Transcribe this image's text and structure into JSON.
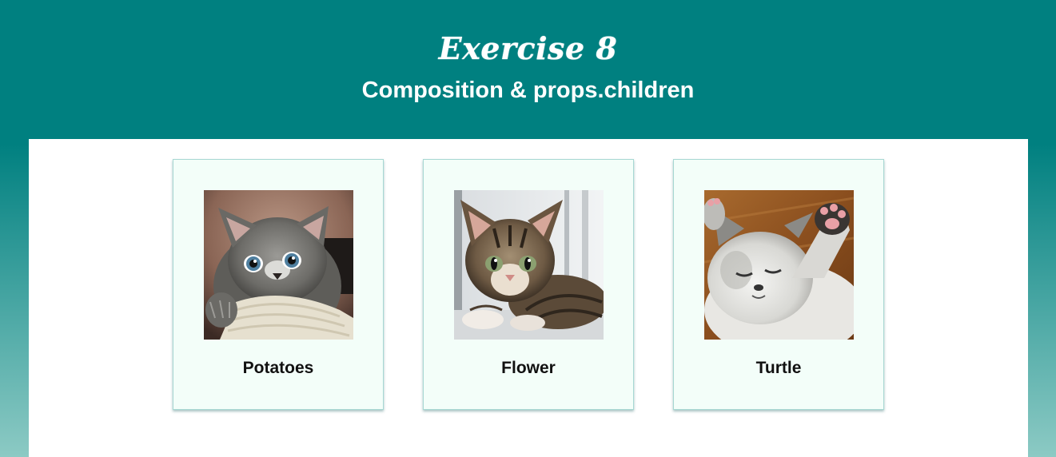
{
  "header": {
    "title": "Exercise 8",
    "subtitle": "Composition & props.children"
  },
  "cards": [
    {
      "name": "Potatoes",
      "image": "gray-fluffy-kitten-photo"
    },
    {
      "name": "Flower",
      "image": "tabby-kitten-by-window-photo"
    },
    {
      "name": "Turtle",
      "image": "sleeping-white-kitten-photo"
    }
  ],
  "colors": {
    "header_bg": "#008080",
    "gradient_bottom": "#8ccac4",
    "card_bg": "#f3fef9",
    "card_border": "#a7d8d3"
  }
}
